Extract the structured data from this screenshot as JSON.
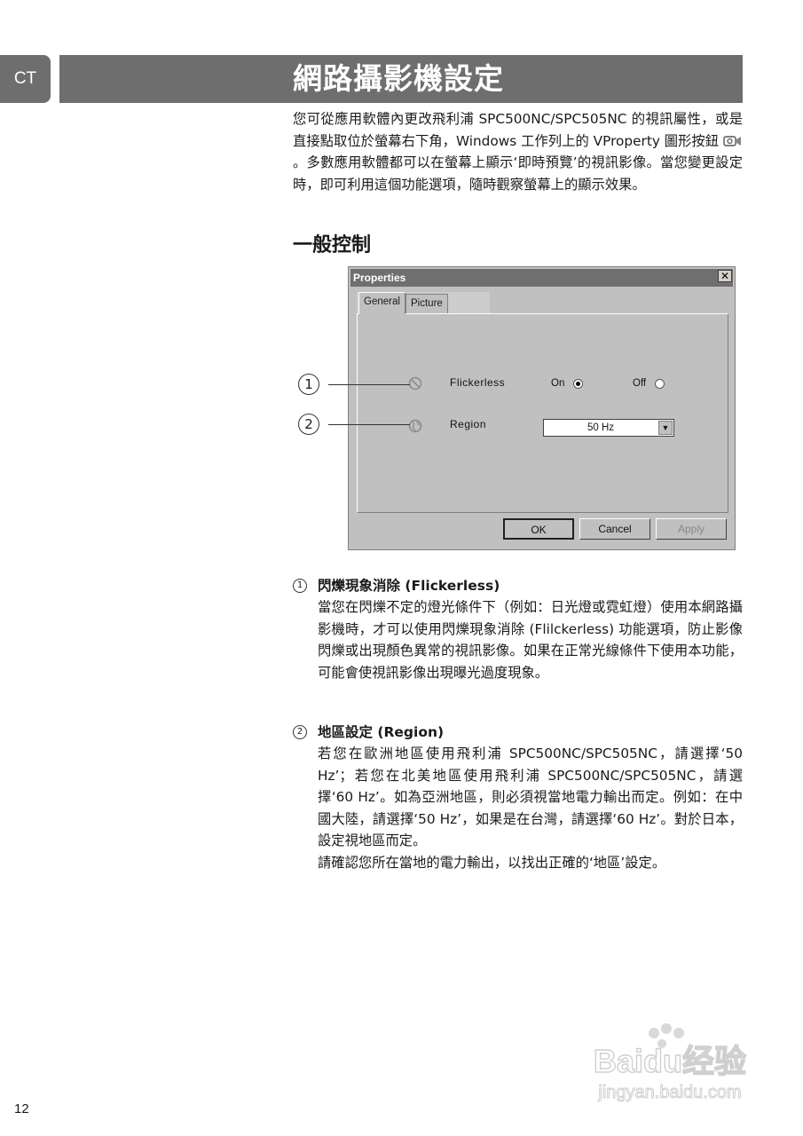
{
  "header": {
    "lang_tab": "CT",
    "title": "網路攝影機設定"
  },
  "intro": {
    "part1": "您可從應用軟體內更改飛利浦 SPC500NC/SPC505NC 的視訊屬性，或是直接點取位於螢幕右下角，Windows 工作列上的 VProperty 圖形按鈕",
    "part2": "。多數應用軟體都可以在螢幕上顯示‘即時預覽’的視訊影像。當您變更設定時，即可利用這個功能選項，隨時觀察螢幕上的顯示效果。",
    "icon": "vproperty-icon"
  },
  "section": {
    "title": "一般控制"
  },
  "dialog": {
    "title": "Properties",
    "close": "✕",
    "tabs": [
      "General",
      "Picture"
    ],
    "rows": {
      "flickerless": {
        "label": "Flickerless",
        "icon": "flicker-icon",
        "on_label": "On",
        "off_label": "Off",
        "selected": "On"
      },
      "region": {
        "label": "Region",
        "icon": "globe-icon",
        "value": "50 Hz"
      }
    },
    "buttons": {
      "ok": "OK",
      "cancel": "Cancel",
      "apply": "Apply"
    }
  },
  "callouts": [
    "1",
    "2"
  ],
  "items": [
    {
      "num": "1",
      "title": "閃爍現象消除 (Flickerless)",
      "body": "當您在閃爍不定的燈光條件下（例如：日光燈或霓虹燈）使用本網路攝影機時，才可以使用閃爍現象消除 (Flilckerless) 功能選項，防止影像閃爍或出現顏色異常的視訊影像。如果在正常光線條件下使用本功能，可能會使視訊影像出現曝光過度現象。"
    },
    {
      "num": "2",
      "title": "地區設定 (Region)",
      "body": "若您在歐洲地區使用飛利浦 SPC500NC/SPC505NC，請選擇‘50 Hz’；若您在北美地區使用飛利浦 SPC500NC/SPC505NC，請選擇‘60 Hz’。如為亞洲地區，則必須視當地電力輸出而定。例如：在中國大陸，請選擇‘50 Hz’，如果是在台灣，請選擇‘60 Hz’。對於日本，設定視地區而定。",
      "body2": "請確認您所在當地的電力輸出，以找出正確的‘地區’設定。"
    }
  ],
  "footer": {
    "page_number": "12",
    "watermark_brand": "Baidu经验",
    "watermark_url": "jingyan.baidu.com"
  }
}
